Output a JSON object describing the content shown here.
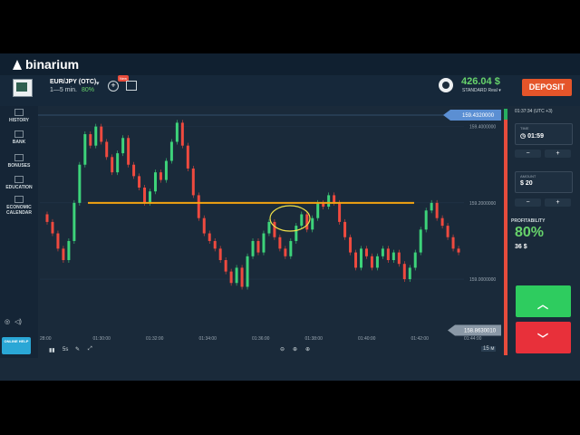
{
  "brand": {
    "name": "binarium"
  },
  "asset": {
    "name": "EUR/JPY (OTC)",
    "timeframe": "1—5 min.",
    "payout": "80%",
    "new_badge": "New"
  },
  "account": {
    "balance": "426.04 $",
    "type": "STANDARD Real ▾"
  },
  "header": {
    "deposit_label": "DEPOSIT"
  },
  "sidebar": {
    "items": [
      {
        "label": "HISTORY"
      },
      {
        "label": "BANK"
      },
      {
        "label": "BONUSES"
      },
      {
        "label": "EDUCATION"
      },
      {
        "label": "ECONOMIC CALENDAR"
      }
    ],
    "help_label": "ONLINE HELP"
  },
  "chart": {
    "price_high": "159.4320000",
    "price_current": "158.8630010",
    "y_ticks": [
      "159.4000000",
      "159.2000000",
      "159.0000000"
    ],
    "x_ticks": [
      "28:00",
      "01:30:00",
      "01:32:00",
      "01:34:00",
      "01:36:00",
      "01:38:00",
      "01:40:00",
      "01:42:00",
      "01:44:00"
    ],
    "interval": "15 м",
    "timeframe_label": "5s"
  },
  "chart_data": {
    "type": "candlestick",
    "ylim": [
      158.86,
      159.43
    ],
    "y_ticks": [
      159.4,
      159.2,
      159.0
    ],
    "x_ticks": [
      "28:00",
      "01:30:00",
      "01:32:00",
      "01:34:00",
      "01:36:00",
      "01:38:00",
      "01:40:00",
      "01:42:00",
      "01:44:00"
    ],
    "candles": [
      [
        159.17,
        159.15
      ],
      [
        159.15,
        159.12
      ],
      [
        159.12,
        159.08
      ],
      [
        159.08,
        159.05
      ],
      [
        159.05,
        159.1
      ],
      [
        159.1,
        159.2
      ],
      [
        159.2,
        159.3
      ],
      [
        159.3,
        159.38
      ],
      [
        159.38,
        159.35
      ],
      [
        159.35,
        159.4
      ],
      [
        159.4,
        159.36
      ],
      [
        159.36,
        159.32
      ],
      [
        159.32,
        159.28
      ],
      [
        159.28,
        159.33
      ],
      [
        159.33,
        159.37
      ],
      [
        159.37,
        159.3
      ],
      [
        159.3,
        159.27
      ],
      [
        159.27,
        159.24
      ],
      [
        159.24,
        159.2
      ],
      [
        159.2,
        159.23
      ],
      [
        159.23,
        159.28
      ],
      [
        159.28,
        159.26
      ],
      [
        159.26,
        159.31
      ],
      [
        159.31,
        159.36
      ],
      [
        159.36,
        159.41
      ],
      [
        159.41,
        159.35
      ],
      [
        159.35,
        159.29
      ],
      [
        159.29,
        159.22
      ],
      [
        159.22,
        159.16
      ],
      [
        159.16,
        159.12
      ],
      [
        159.12,
        159.1
      ],
      [
        159.1,
        159.08
      ],
      [
        159.08,
        159.05
      ],
      [
        159.05,
        159.02
      ],
      [
        159.02,
        158.99
      ],
      [
        158.99,
        159.03
      ],
      [
        159.03,
        158.98
      ],
      [
        158.98,
        159.06
      ],
      [
        159.06,
        159.1
      ],
      [
        159.1,
        159.07
      ],
      [
        159.07,
        159.12
      ],
      [
        159.12,
        159.15
      ],
      [
        159.15,
        159.11
      ],
      [
        159.11,
        159.08
      ],
      [
        159.08,
        159.06
      ],
      [
        159.06,
        159.1
      ],
      [
        159.1,
        159.14
      ],
      [
        159.14,
        159.17
      ],
      [
        159.17,
        159.13
      ],
      [
        159.13,
        159.16
      ],
      [
        159.16,
        159.2
      ],
      [
        159.2,
        159.19
      ],
      [
        159.19,
        159.22
      ],
      [
        159.22,
        159.2
      ],
      [
        159.2,
        159.15
      ],
      [
        159.15,
        159.11
      ],
      [
        159.11,
        159.07
      ],
      [
        159.07,
        159.03
      ],
      [
        159.03,
        159.08
      ],
      [
        159.08,
        159.06
      ],
      [
        159.06,
        159.03
      ],
      [
        159.03,
        159.06
      ],
      [
        159.06,
        159.08
      ],
      [
        159.08,
        159.05
      ],
      [
        159.05,
        159.07
      ],
      [
        159.07,
        159.04
      ],
      [
        159.04,
        159.0
      ],
      [
        159.0,
        159.03
      ],
      [
        159.03,
        159.07
      ],
      [
        159.07,
        159.13
      ],
      [
        159.13,
        159.18
      ],
      [
        159.18,
        159.2
      ],
      [
        159.2,
        159.16
      ],
      [
        159.16,
        159.14
      ],
      [
        159.14,
        159.11
      ],
      [
        159.11,
        159.08
      ],
      [
        159.08,
        159.07
      ]
    ],
    "series": [
      {
        "name": "",
        "values": [
          159.2
        ]
      }
    ]
  },
  "colors": {
    "up": "#3dd37a",
    "down": "#ef4a3f",
    "trendline": "#f3a312",
    "circle": "#f0e24a",
    "bg": "#1a2a3a",
    "accent": "#2ecc5f",
    "danger": "#e8303a"
  },
  "panel": {
    "clock": "01:37:34 (UTC +3)",
    "time_label": "TIME",
    "time_value": "01:59",
    "amount_label": "AMOUNT",
    "amount_value": "$ 20",
    "profitability_label": "PROFITABILITY",
    "profitability_value": "80%",
    "profit_amount": "36 $"
  }
}
